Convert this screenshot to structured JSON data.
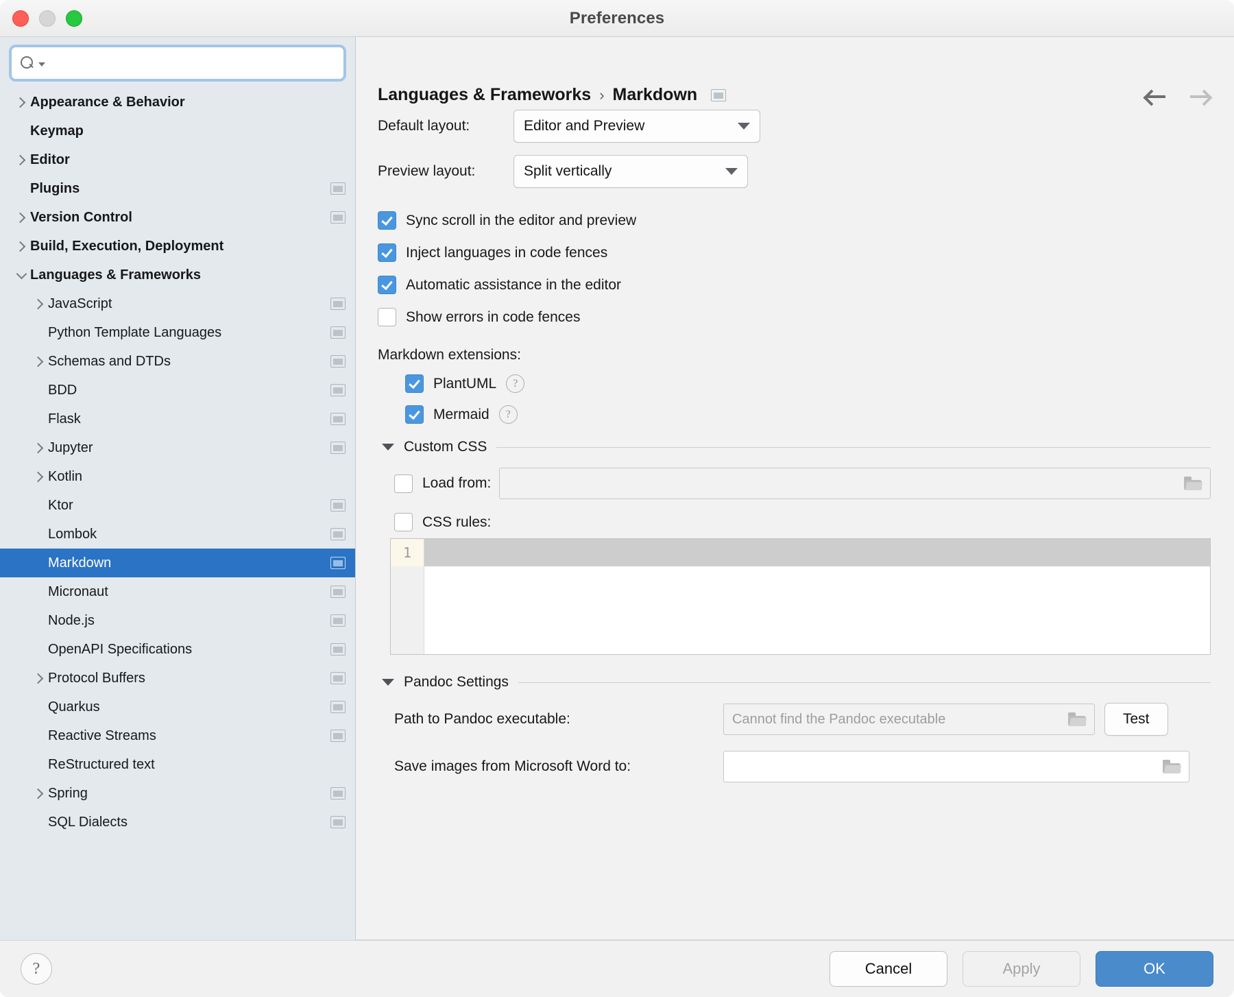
{
  "window": {
    "title": "Preferences",
    "traffic_lights": [
      "close",
      "minimize",
      "zoom"
    ]
  },
  "search": {
    "value": "",
    "placeholder": "",
    "icon": "search-icon"
  },
  "sidebar": {
    "items": [
      {
        "label": "Appearance & Behavior",
        "level": 0,
        "bold": true,
        "arrow": "right",
        "badge": false,
        "selected": false
      },
      {
        "label": "Keymap",
        "level": 0,
        "bold": true,
        "arrow": "none",
        "badge": false,
        "selected": false
      },
      {
        "label": "Editor",
        "level": 0,
        "bold": true,
        "arrow": "right",
        "badge": false,
        "selected": false
      },
      {
        "label": "Plugins",
        "level": 0,
        "bold": true,
        "arrow": "none",
        "badge": true,
        "selected": false
      },
      {
        "label": "Version Control",
        "level": 0,
        "bold": true,
        "arrow": "right",
        "badge": true,
        "selected": false
      },
      {
        "label": "Build, Execution, Deployment",
        "level": 0,
        "bold": true,
        "arrow": "right",
        "badge": false,
        "selected": false
      },
      {
        "label": "Languages & Frameworks",
        "level": 0,
        "bold": true,
        "arrow": "down",
        "badge": false,
        "selected": false
      },
      {
        "label": "JavaScript",
        "level": 1,
        "bold": false,
        "arrow": "right",
        "badge": true,
        "selected": false
      },
      {
        "label": "Python Template Languages",
        "level": 1,
        "bold": false,
        "arrow": "none",
        "badge": true,
        "selected": false
      },
      {
        "label": "Schemas and DTDs",
        "level": 1,
        "bold": false,
        "arrow": "right",
        "badge": true,
        "selected": false
      },
      {
        "label": "BDD",
        "level": 1,
        "bold": false,
        "arrow": "none",
        "badge": true,
        "selected": false
      },
      {
        "label": "Flask",
        "level": 1,
        "bold": false,
        "arrow": "none",
        "badge": true,
        "selected": false
      },
      {
        "label": "Jupyter",
        "level": 1,
        "bold": false,
        "arrow": "right",
        "badge": true,
        "selected": false
      },
      {
        "label": "Kotlin",
        "level": 1,
        "bold": false,
        "arrow": "right",
        "badge": false,
        "selected": false
      },
      {
        "label": "Ktor",
        "level": 1,
        "bold": false,
        "arrow": "none",
        "badge": true,
        "selected": false
      },
      {
        "label": "Lombok",
        "level": 1,
        "bold": false,
        "arrow": "none",
        "badge": true,
        "selected": false
      },
      {
        "label": "Markdown",
        "level": 1,
        "bold": false,
        "arrow": "none",
        "badge": true,
        "selected": true
      },
      {
        "label": "Micronaut",
        "level": 1,
        "bold": false,
        "arrow": "none",
        "badge": true,
        "selected": false
      },
      {
        "label": "Node.js",
        "level": 1,
        "bold": false,
        "arrow": "none",
        "badge": true,
        "selected": false
      },
      {
        "label": "OpenAPI Specifications",
        "level": 1,
        "bold": false,
        "arrow": "none",
        "badge": true,
        "selected": false
      },
      {
        "label": "Protocol Buffers",
        "level": 1,
        "bold": false,
        "arrow": "right",
        "badge": true,
        "selected": false
      },
      {
        "label": "Quarkus",
        "level": 1,
        "bold": false,
        "arrow": "none",
        "badge": true,
        "selected": false
      },
      {
        "label": "Reactive Streams",
        "level": 1,
        "bold": false,
        "arrow": "none",
        "badge": true,
        "selected": false
      },
      {
        "label": "ReStructured text",
        "level": 1,
        "bold": false,
        "arrow": "none",
        "badge": false,
        "selected": false
      },
      {
        "label": "Spring",
        "level": 1,
        "bold": false,
        "arrow": "right",
        "badge": true,
        "selected": false
      },
      {
        "label": "SQL Dialects",
        "level": 1,
        "bold": false,
        "arrow": "none",
        "badge": true,
        "selected": false
      }
    ]
  },
  "main": {
    "breadcrumb": {
      "parent": "Languages & Frameworks",
      "separator": "›",
      "current": "Markdown"
    },
    "nav": {
      "back": "back-arrow",
      "forward": "forward-arrow"
    },
    "default_layout": {
      "label": "Default layout:",
      "value": "Editor and Preview"
    },
    "preview_layout": {
      "label": "Preview layout:",
      "value": "Split vertically"
    },
    "checkboxes": [
      {
        "label": "Sync scroll in the editor and preview",
        "checked": true
      },
      {
        "label": "Inject languages in code fences",
        "checked": true
      },
      {
        "label": "Automatic assistance in the editor",
        "checked": true
      },
      {
        "label": "Show errors in code fences",
        "checked": false
      }
    ],
    "extensions": {
      "title": "Markdown extensions:",
      "items": [
        {
          "label": "PlantUML",
          "checked": true,
          "help": "?"
        },
        {
          "label": "Mermaid",
          "checked": true,
          "help": "?"
        }
      ]
    },
    "custom_css": {
      "title": "Custom CSS",
      "load_from": {
        "label": "Load from:",
        "checked": false,
        "value": "",
        "placeholder": ""
      },
      "css_rules": {
        "label": "CSS rules:",
        "checked": false
      },
      "editor": {
        "line_number": "1",
        "content": ""
      }
    },
    "pandoc": {
      "title": "Pandoc Settings",
      "path": {
        "label": "Path to Pandoc executable:",
        "value": "",
        "placeholder": "Cannot find the Pandoc executable"
      },
      "test_button": "Test",
      "save_images": {
        "label": "Save images from Microsoft Word to:",
        "value": "",
        "placeholder": ""
      }
    }
  },
  "footer": {
    "help": "?",
    "cancel": "Cancel",
    "apply": "Apply",
    "ok": "OK"
  },
  "colors": {
    "selection": "#2b73c4",
    "checkbox_on": "#4a97e0",
    "primary_button": "#4a8bcc",
    "sidebar_bg": "#e4e9ed"
  }
}
